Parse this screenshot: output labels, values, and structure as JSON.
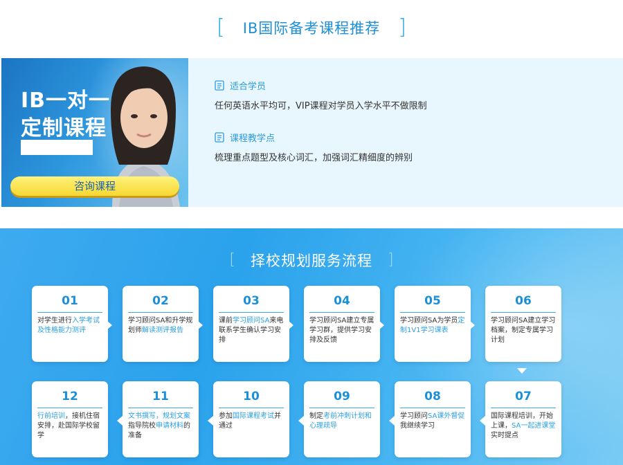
{
  "section1": {
    "title": "IB国际备考课程推荐",
    "bracket_left": "[",
    "bracket_right": "]"
  },
  "course": {
    "banner_line1": "IB一对一",
    "banner_line2": "定制课程",
    "consult_button": "咨询课程",
    "audience_label": "适合学员",
    "audience_text": "任何英语水平均可，VIP课程对学员入学水平不做限制",
    "points_label": "课程教学点",
    "points_text": "梳理重点题型及核心词汇，加强词汇精细度的辨别"
  },
  "section2": {
    "title": "择校规划服务流程",
    "bracket_left": "[",
    "bracket_right": "]"
  },
  "steps": [
    {
      "num": "01",
      "parts": [
        [
          "对学生进行",
          0
        ],
        [
          "入学考试及性格能力测评",
          1
        ]
      ]
    },
    {
      "num": "02",
      "parts": [
        [
          "学习顾问SA和升学规划师",
          0
        ],
        [
          "解读测评报告",
          1
        ]
      ]
    },
    {
      "num": "03",
      "parts": [
        [
          "课前",
          0
        ],
        [
          "学习顾问SA",
          1
        ],
        [
          "来电联系学生确认学习安排",
          0
        ]
      ]
    },
    {
      "num": "04",
      "parts": [
        [
          "学习顾问SA建立专属学习群，提供学习安排及反馈",
          0
        ]
      ]
    },
    {
      "num": "05",
      "parts": [
        [
          "学习顾问SA为学员",
          0
        ],
        [
          "定制1V1学习课表",
          1
        ]
      ]
    },
    {
      "num": "06",
      "parts": [
        [
          "学习顾问SA建立学习档案，制定专属学习计划",
          0
        ]
      ]
    },
    {
      "num": "07",
      "parts": [
        [
          "国际课程培训，开始上课，",
          0
        ],
        [
          "SA一起进课堂",
          1
        ],
        [
          "实时提点",
          0
        ]
      ]
    },
    {
      "num": "08",
      "parts": [
        [
          "学习顾问",
          0
        ],
        [
          "SA课外督促",
          1
        ],
        [
          "我继续学习",
          0
        ]
      ]
    },
    {
      "num": "09",
      "parts": [
        [
          "制定",
          0
        ],
        [
          "考前冲刺计划和心理疏导",
          1
        ]
      ]
    },
    {
      "num": "10",
      "parts": [
        [
          "参加",
          0
        ],
        [
          "国际课程考试",
          1
        ],
        [
          "并通过",
          0
        ]
      ]
    },
    {
      "num": "11",
      "parts": [
        [
          "文书撰写，规划文案",
          1
        ],
        [
          "指导院校",
          0
        ],
        [
          "申请材料",
          1
        ],
        [
          "的准备",
          0
        ]
      ]
    },
    {
      "num": "12",
      "parts": [
        [
          "行前培训",
          1
        ],
        [
          "，接机住宿安排，赴国际学校留学",
          0
        ]
      ]
    }
  ],
  "colors": {
    "accent": "#2aa7e8",
    "highlight": "#2ba0e4",
    "button": "#f6d832"
  }
}
